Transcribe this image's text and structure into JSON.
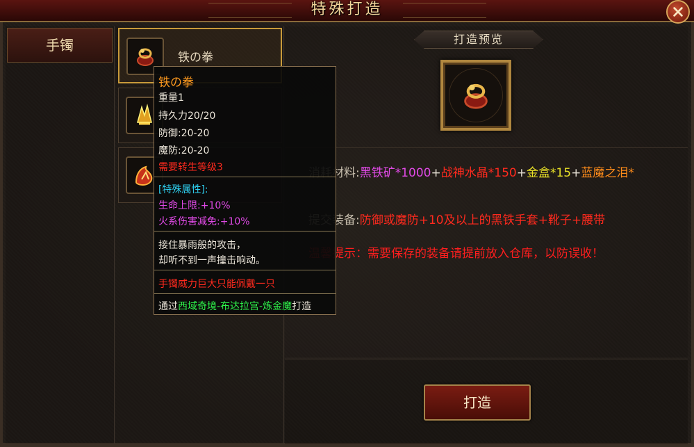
{
  "window": {
    "title": "特殊打造",
    "close_label": "×"
  },
  "category": {
    "label": "手镯"
  },
  "items": [
    {
      "name": "铁の拳",
      "icon": "red-bracelet-icon"
    },
    {
      "name": "",
      "icon": "gold-claw-icon"
    },
    {
      "name": "",
      "icon": "flame-gauntlet-icon"
    }
  ],
  "preview": {
    "banner": "打造预览",
    "icon": "red-bracelet-icon"
  },
  "materials": {
    "label": "消耗材料:",
    "parts": [
      "黑铁矿*1000",
      "+",
      "战神水晶*150",
      "+",
      "金盒*15",
      "+",
      "蓝魔之泪*"
    ]
  },
  "submit": {
    "label": "提交装备:",
    "text": "防御或魔防+10及以上的黑铁手套+靴子+腰带"
  },
  "warning": {
    "text": "温馨提示：需要保存的装备请提前放入仓库，以防误收！"
  },
  "forge_button": "打造",
  "tooltip": {
    "name": "铁の拳",
    "weight": "重量1",
    "durability": "持久力20/20",
    "defense": "防御:20-20",
    "magic_defense": "魔防:20-20",
    "requirement": "需要转生等级3",
    "special_header": "[特殊属性]:",
    "hp": "生命上限:+10%",
    "fire": "火系伤害减免:+10%",
    "desc1": "接住暴雨般的攻击，",
    "desc2": "却听不到一声撞击响动。",
    "warning": "手镯威力巨大只能佩戴一只",
    "source_prefix": "通过",
    "source_place": "西域奇境-布达拉宫-炼金魔",
    "source_suffix": "打造"
  },
  "colors": {
    "title_gold": "#f3d59a",
    "purple": "#e04ae6",
    "red": "#ff2a1e",
    "yellow": "#e8e027",
    "orange": "#ff8c1a",
    "tooltip_name": "#ff9a1f",
    "tooltip_cyan": "#2fd0f0",
    "tooltip_green": "#2ef24a"
  }
}
